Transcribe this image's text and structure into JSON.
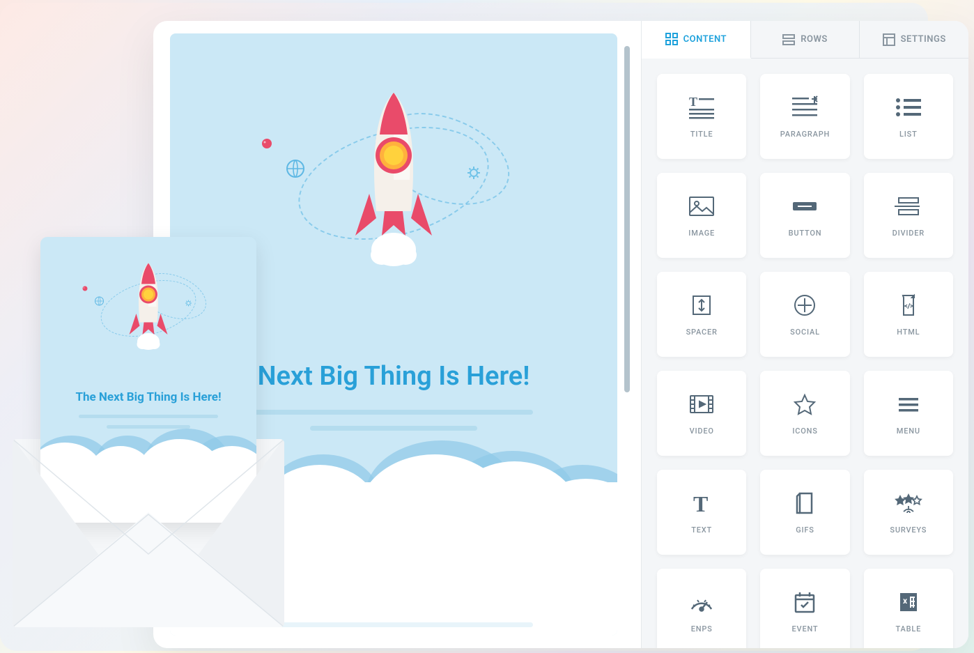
{
  "tabs": {
    "content": "CONTENT",
    "rows": "ROWS",
    "settings": "SETTINGS"
  },
  "blocks": {
    "title": "TITLE",
    "paragraph": "PARAGRAPH",
    "list": "LIST",
    "image": "IMAGE",
    "button": "BUTTON",
    "divider": "DIVIDER",
    "spacer": "SPACER",
    "social": "SOCIAL",
    "html": "HTML",
    "video": "VIDEO",
    "icons": "ICONS",
    "menu": "MENU",
    "text": "TEXT",
    "gifs": "GIFS",
    "surveys": "SURVEYS",
    "enps": "ENPS",
    "event": "EVENT",
    "table": "TABLE"
  },
  "canvas": {
    "headline": "Next Big Thing Is Here!"
  },
  "preview": {
    "headline": "The Next Big Thing Is Here!"
  }
}
